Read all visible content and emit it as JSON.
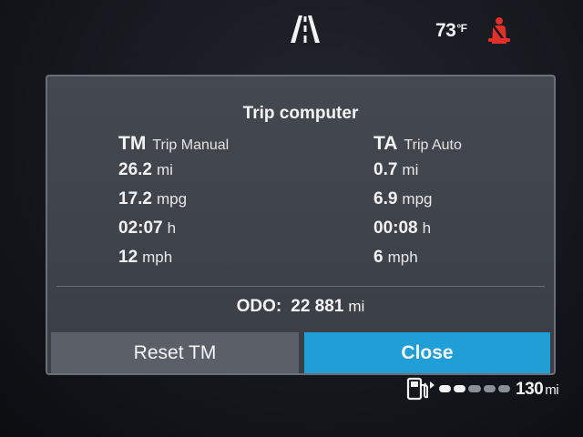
{
  "status_bar": {
    "lane_icon": "lane-assist-icon",
    "temperature": "73",
    "temperature_unit": "°F",
    "warning_icon": "seatbelt-warning-icon",
    "warning_color": "#e0302a"
  },
  "dialog": {
    "title": "Trip computer",
    "trip_manual": {
      "abbr": "TM",
      "label": "Trip Manual",
      "distance": {
        "value": "26.2",
        "unit": "mi"
      },
      "economy": {
        "value": "17.2",
        "unit": "mpg"
      },
      "time": {
        "value": "02:07",
        "unit": "h"
      },
      "speed": {
        "value": "12",
        "unit": "mph"
      }
    },
    "trip_auto": {
      "abbr": "TA",
      "label": "Trip Auto",
      "distance": {
        "value": "0.7",
        "unit": "mi"
      },
      "economy": {
        "value": "6.9",
        "unit": "mpg"
      },
      "time": {
        "value": "00:08",
        "unit": "h"
      },
      "speed": {
        "value": "6",
        "unit": "mph"
      }
    },
    "odometer": {
      "label": "ODO:",
      "value": "22 881",
      "unit": "mi"
    },
    "buttons": {
      "reset_label": "Reset TM",
      "close_label": "Close"
    }
  },
  "fuel": {
    "icon": "fuel-pump-icon",
    "level_segments_filled": 2,
    "level_segments_total": 5,
    "range_value": "130",
    "range_unit": "mi"
  },
  "colors": {
    "accent": "#1f9fd6",
    "dialog_bg": "#3f434a"
  }
}
